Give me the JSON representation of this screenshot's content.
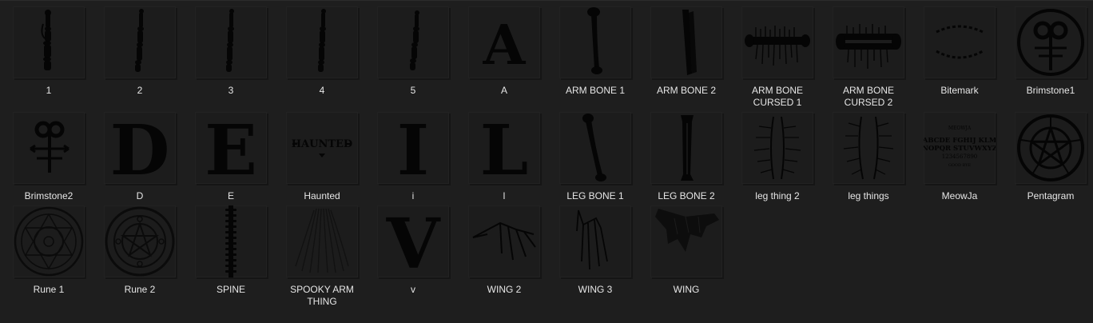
{
  "files": [
    {
      "name": "1",
      "icon": "bone-finger-icon"
    },
    {
      "name": "2",
      "icon": "bone-finger-icon"
    },
    {
      "name": "3",
      "icon": "bone-finger-icon"
    },
    {
      "name": "4",
      "icon": "bone-finger-icon"
    },
    {
      "name": "5",
      "icon": "bone-finger-icon"
    },
    {
      "name": "A",
      "icon": "letter-a-icon",
      "glyph": "A"
    },
    {
      "name": "ARM BONE 1",
      "icon": "arm-bone-icon"
    },
    {
      "name": "ARM BONE 2",
      "icon": "arm-bone-icon"
    },
    {
      "name": "ARM BONE CURSED 1",
      "icon": "cursed-bone-icon"
    },
    {
      "name": "ARM BONE CURSED 2",
      "icon": "cursed-bone-icon"
    },
    {
      "name": "Bitemark",
      "icon": "bitemark-icon"
    },
    {
      "name": "Brimstone1",
      "icon": "brimstone-circle-icon"
    },
    {
      "name": "Brimstone2",
      "icon": "brimstone-icon"
    },
    {
      "name": "D",
      "icon": "letter-d-icon",
      "glyph": "D"
    },
    {
      "name": "E",
      "icon": "letter-e-icon",
      "glyph": "E"
    },
    {
      "name": "Haunted",
      "icon": "haunted-text-icon"
    },
    {
      "name": "i",
      "icon": "letter-i-icon",
      "glyph": "I"
    },
    {
      "name": "l",
      "icon": "letter-l-icon",
      "glyph": "L"
    },
    {
      "name": "LEG BONE 1",
      "icon": "leg-bone-icon"
    },
    {
      "name": "LEG BONE 2",
      "icon": "leg-bone-icon"
    },
    {
      "name": "leg thing 2",
      "icon": "leg-thing-icon"
    },
    {
      "name": "leg things",
      "icon": "leg-thing-icon"
    },
    {
      "name": "MeowJa",
      "icon": "ouija-board-icon"
    },
    {
      "name": "Pentagram",
      "icon": "pentagram-icon"
    },
    {
      "name": "Rune 1",
      "icon": "rune-circle-icon"
    },
    {
      "name": "Rune 2",
      "icon": "rune-circle-icon"
    },
    {
      "name": "SPINE",
      "icon": "spine-icon"
    },
    {
      "name": "SPOOKY ARM THING",
      "icon": "spooky-arm-icon"
    },
    {
      "name": "v",
      "icon": "letter-v-icon",
      "glyph": "V"
    },
    {
      "name": "WING 2",
      "icon": "wing-icon"
    },
    {
      "name": "WING 3",
      "icon": "wing-icon"
    },
    {
      "name": "WING",
      "icon": "wing-icon"
    }
  ],
  "thumb_text": {
    "haunted": "HAUNTED",
    "ouija_top": "MEOWJA",
    "ouija_row1": "ABCDE FGHIJ KLM",
    "ouija_row2": "NOPQR STUVWXYZ",
    "ouija_row3": "1234567890",
    "ouija_bottom": "GOOD BYE"
  },
  "colors": {
    "background": "#1e1e1e",
    "thumb": "#1c1c1c",
    "ink": "#050505",
    "label": "#e6e6e6"
  }
}
